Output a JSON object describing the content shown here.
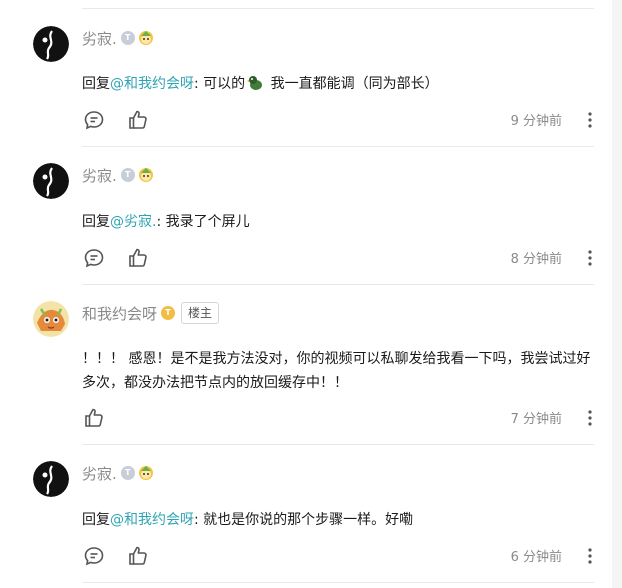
{
  "comments": [
    {
      "username": "劣寂.",
      "level": "T",
      "reply_prefix": "回复",
      "mention": "@和我约会呀",
      "text_before_emoji": ": 可以的",
      "text_after_emoji": " 我一直都能调（同为部长）",
      "time": "9 分钟前"
    },
    {
      "username": "劣寂.",
      "level": "T",
      "reply_prefix": "回复",
      "mention": "@劣寂.",
      "text": ": 我录了个屏儿",
      "time": "8 分钟前"
    },
    {
      "username": "和我约会呀",
      "level": "T",
      "op_label": "楼主",
      "text": "！！！ 感恩！是不是我方法没对，你的视频可以私聊发给我看一下吗，我尝试过好多次，都没办法把节点内的放回缓存中！！",
      "time": "7 分钟前"
    },
    {
      "username": "劣寂.",
      "level": "T",
      "reply_prefix": "回复",
      "mention": "@和我约会呀",
      "text": ": 就也是你说的那个步骤一样。好嘞",
      "time": "6 分钟前"
    }
  ],
  "colors": {
    "mention": "#2fa4b4",
    "meta": "#8a8a8a",
    "divider": "#e8e9eb",
    "level_gray": "#c8ced8",
    "level_gold": "#f2bd45"
  },
  "icons": {
    "comment": "comment-bubble-icon",
    "like": "thumbs-up-icon",
    "more": "more-vertical-icon",
    "pet": "pet-badge-icon",
    "emoji": "duck-emoji-icon"
  }
}
